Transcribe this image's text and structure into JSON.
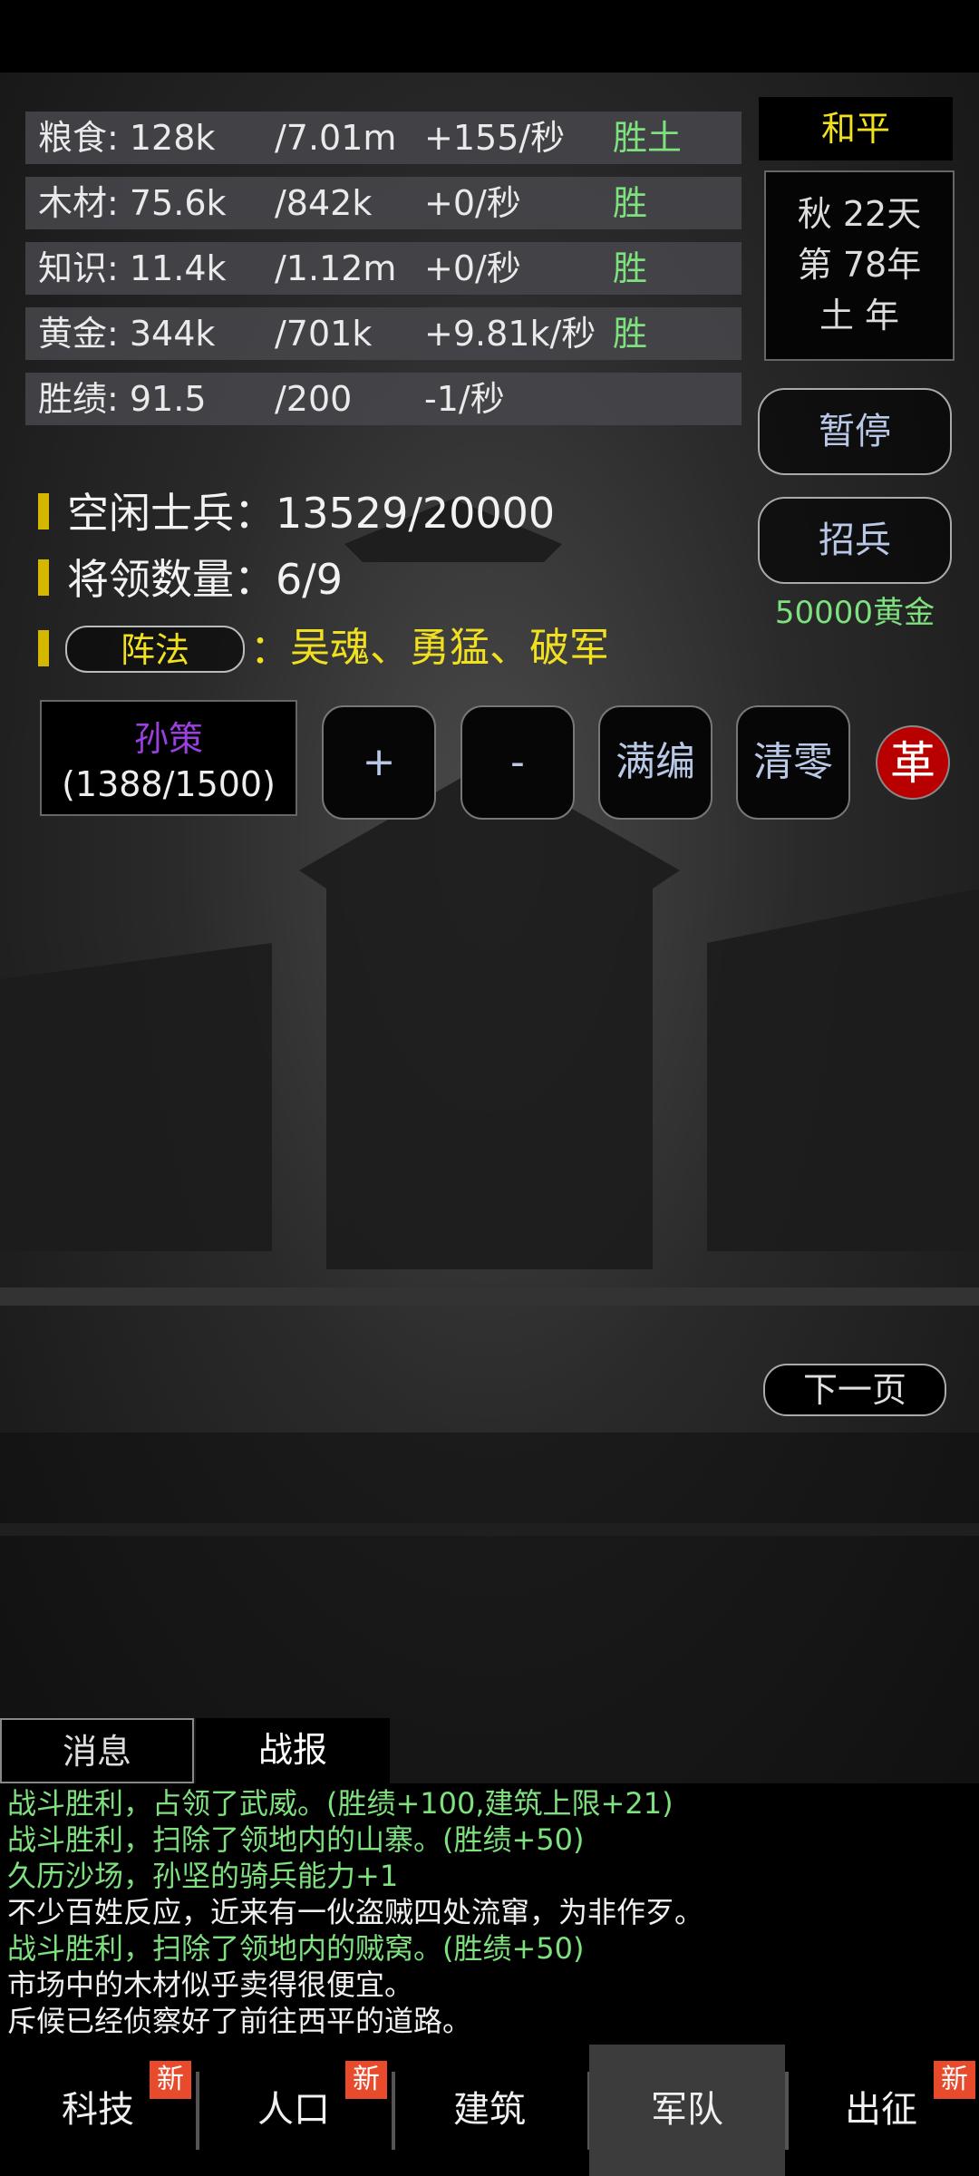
{
  "resources": [
    {
      "name": "粮食: 128k",
      "max": "/7.01m",
      "rate": "+155/秒",
      "tag": "胜土"
    },
    {
      "name": "木材: 75.6k",
      "max": "/842k",
      "rate": "+0/秒",
      "tag": "胜"
    },
    {
      "name": "知识: 11.4k",
      "max": "/1.12m",
      "rate": "+0/秒",
      "tag": "胜"
    },
    {
      "name": "黄金: 344k",
      "max": "/701k",
      "rate": "+9.81k/秒",
      "tag": "胜"
    },
    {
      "name": "胜绩: 91.5",
      "max": "/200",
      "rate": "-1/秒",
      "tag": ""
    }
  ],
  "status": {
    "peace": "和平",
    "calendar_line1": "秋 22天",
    "calendar_line2": "第 78年",
    "calendar_line3": "土 年"
  },
  "buttons": {
    "pause": "暂停",
    "recruit": "招兵",
    "recruit_cost": "50000黄金",
    "formation": "阵法",
    "plus": "+",
    "minus": "-",
    "full": "满编",
    "clear": "清零",
    "reform": "革",
    "next_page": "下一页"
  },
  "army": {
    "idle_soldiers": "空闲士兵：13529/20000",
    "generals_count": "将领数量：6/9",
    "formation_colon": "：",
    "formation_skills": "吴魂、勇猛、破军",
    "general_name": "孙策",
    "general_troops": "(1388/1500)"
  },
  "tabs": [
    "消息",
    "战报"
  ],
  "log": [
    {
      "text": "战斗胜利，占领了武威。(胜绩+100,建筑上限+21)",
      "color": "green"
    },
    {
      "text": "战斗胜利，扫除了领地内的山寨。(胜绩+50)",
      "color": "green"
    },
    {
      "text": "久历沙场，孙坚的骑兵能力+1",
      "color": "green"
    },
    {
      "text": "不少百姓反应，近来有一伙盗贼四处流窜，为非作歹。",
      "color": "white"
    },
    {
      "text": "战斗胜利，扫除了领地内的贼窝。(胜绩+50)",
      "color": "green"
    },
    {
      "text": "市场中的木材似乎卖得很便宜。",
      "color": "white"
    },
    {
      "text": "斥候已经侦察好了前往西平的道路。",
      "color": "white"
    }
  ],
  "nav": [
    {
      "label": "科技",
      "badge": "新"
    },
    {
      "label": "人口",
      "badge": "新"
    },
    {
      "label": "建筑",
      "badge": ""
    },
    {
      "label": "军队",
      "badge": ""
    },
    {
      "label": "出征",
      "badge": "新"
    }
  ],
  "colors": {
    "accent_yellow": "#f0e020",
    "green_text": "#7ee07e",
    "badge_red": "#e84a2c",
    "reform_red": "#b80000",
    "general_purple": "#9a3fe0"
  }
}
